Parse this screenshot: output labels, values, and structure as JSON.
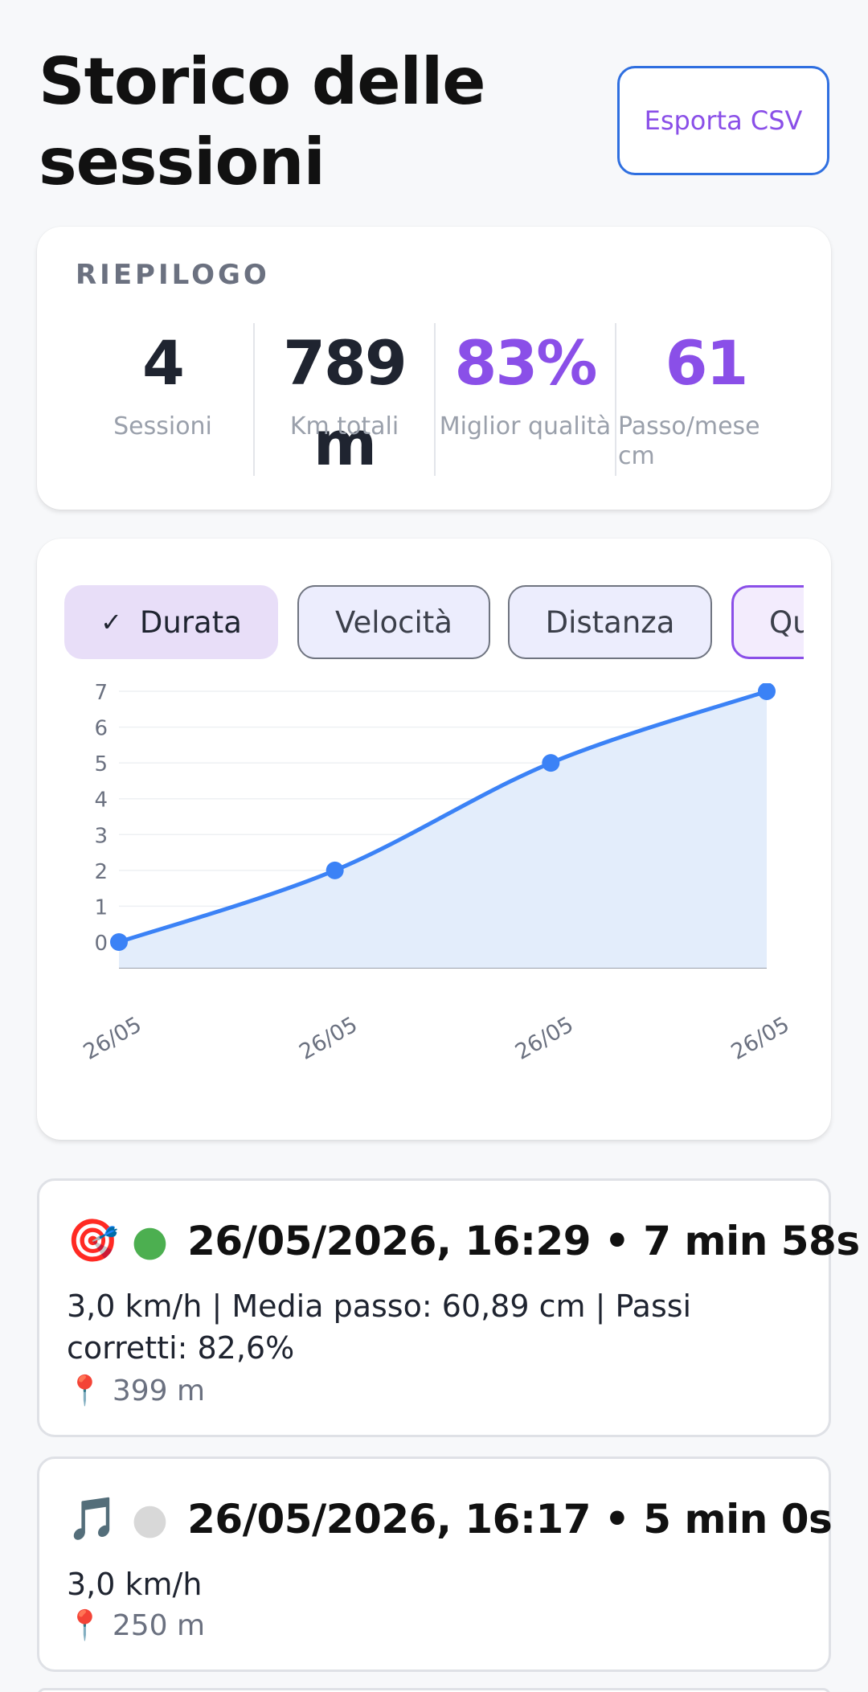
{
  "header": {
    "title": "Storico delle sessioni",
    "export_label": "Esporta CSV"
  },
  "summary": {
    "label": "RIEPILOGO",
    "stats": [
      {
        "value": "4",
        "label": "Sessioni",
        "color": "#1f2430"
      },
      {
        "value": "789 m",
        "label": "Km totali",
        "color": "#1f2430"
      },
      {
        "value": "83%",
        "label": "Miglior qualità",
        "color": "#8a4fe8"
      },
      {
        "value": "61",
        "label": "Passo/mese",
        "sub": "cm",
        "color": "#8a4fe8"
      }
    ]
  },
  "chips": [
    {
      "label": "Durata",
      "selected": true
    },
    {
      "label": "Velocità",
      "selected": false
    },
    {
      "label": "Distanza",
      "selected": false
    },
    {
      "label": "Qu",
      "selected": false
    }
  ],
  "chart_data": {
    "type": "area",
    "x": [
      "26/05",
      "26/05",
      "26/05",
      "26/05"
    ],
    "y": [
      0,
      2,
      5,
      7
    ],
    "ylim": [
      0,
      7
    ],
    "yticks": [
      0,
      1,
      2,
      3,
      4,
      5,
      6,
      7
    ],
    "grid": true,
    "color": "#3b82f6",
    "fill": "#e3edfb"
  },
  "sessions": [
    {
      "icon_1": "target-icon",
      "icon_2": "green-circle-icon",
      "title": "26/05/2026, 16:29  •  7 min 58s",
      "detail": "3,0 km/h  |  Media passo: 60,89 cm | Passi corretti: 82,6%",
      "distance": "399 m"
    },
    {
      "icon_1": "music-note-icon",
      "icon_2": "white-circle-icon",
      "title": "26/05/2026, 16:17  •  5 min 0s",
      "detail": "3,0 km/h",
      "distance": "250 m"
    }
  ]
}
